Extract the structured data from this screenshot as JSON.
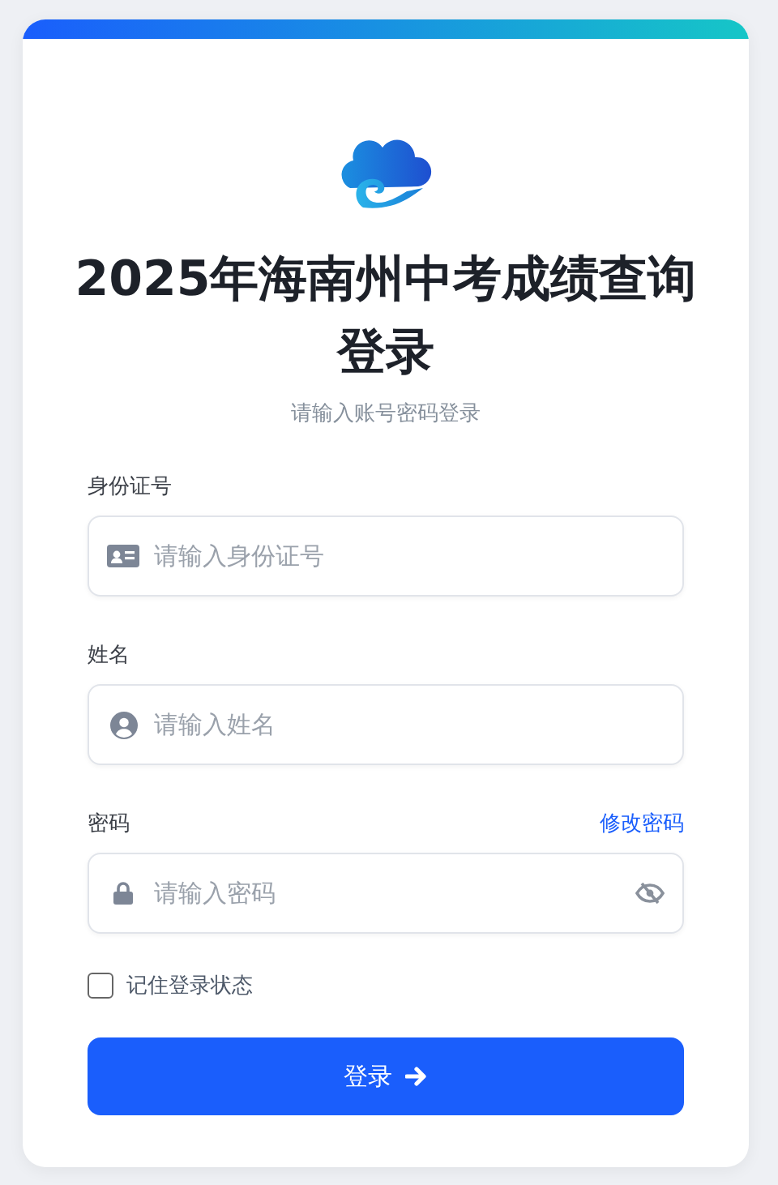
{
  "title": "2025年海南州中考成绩查询登录",
  "subtitle": "请输入账号密码登录",
  "fields": [
    {
      "kind": "idcard",
      "label": "身份证号",
      "placeholder": "请输入身份证号"
    },
    {
      "kind": "user",
      "label": "姓名",
      "placeholder": "请输入姓名"
    },
    {
      "kind": "password",
      "label": "密码",
      "placeholder": "请输入密码",
      "link": "修改密码"
    }
  ],
  "remember": {
    "label": "记住登录状态",
    "checked": false
  },
  "submit": "登录"
}
